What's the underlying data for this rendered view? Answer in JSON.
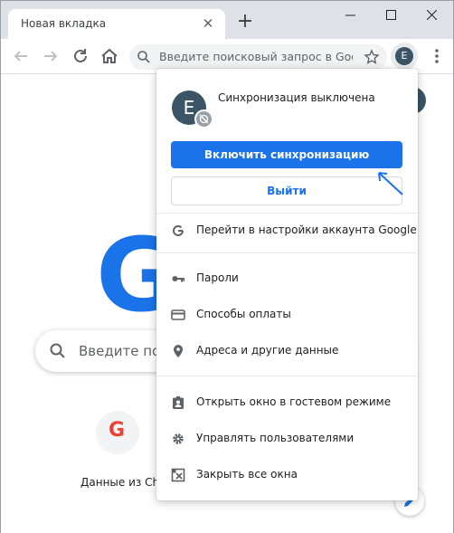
{
  "tab": {
    "title": "Новая вкладка"
  },
  "omnibox": {
    "placeholder": "Введите поисковый запрос в Google или URL"
  },
  "profile": {
    "initial": "E"
  },
  "page": {
    "search_placeholder": "Введите поисковый запрос",
    "shortcut_label": "Данные из Chrome"
  },
  "menu": {
    "sync_status": "Синхронизация выключена",
    "enable_sync": "Включить синхронизацию",
    "sign_out": "Выйти",
    "items": [
      {
        "label": "Перейти в настройки аккаунта Google",
        "icon": "google-g-icon"
      },
      {
        "label": "Пароли",
        "icon": "key-icon"
      },
      {
        "label": "Способы оплаты",
        "icon": "credit-card-icon"
      },
      {
        "label": "Адреса и другие данные",
        "icon": "location-pin-icon"
      },
      {
        "label": "Открыть окно в гостевом режиме",
        "icon": "guest-badge-icon"
      },
      {
        "label": "Управлять пользователями",
        "icon": "gear-icon"
      },
      {
        "label": "Закрыть все окна",
        "icon": "close-window-icon"
      }
    ]
  },
  "colors": {
    "accent": "#1a73e8",
    "avatar": "#3c5566",
    "titlebar": "#dee1e6"
  }
}
